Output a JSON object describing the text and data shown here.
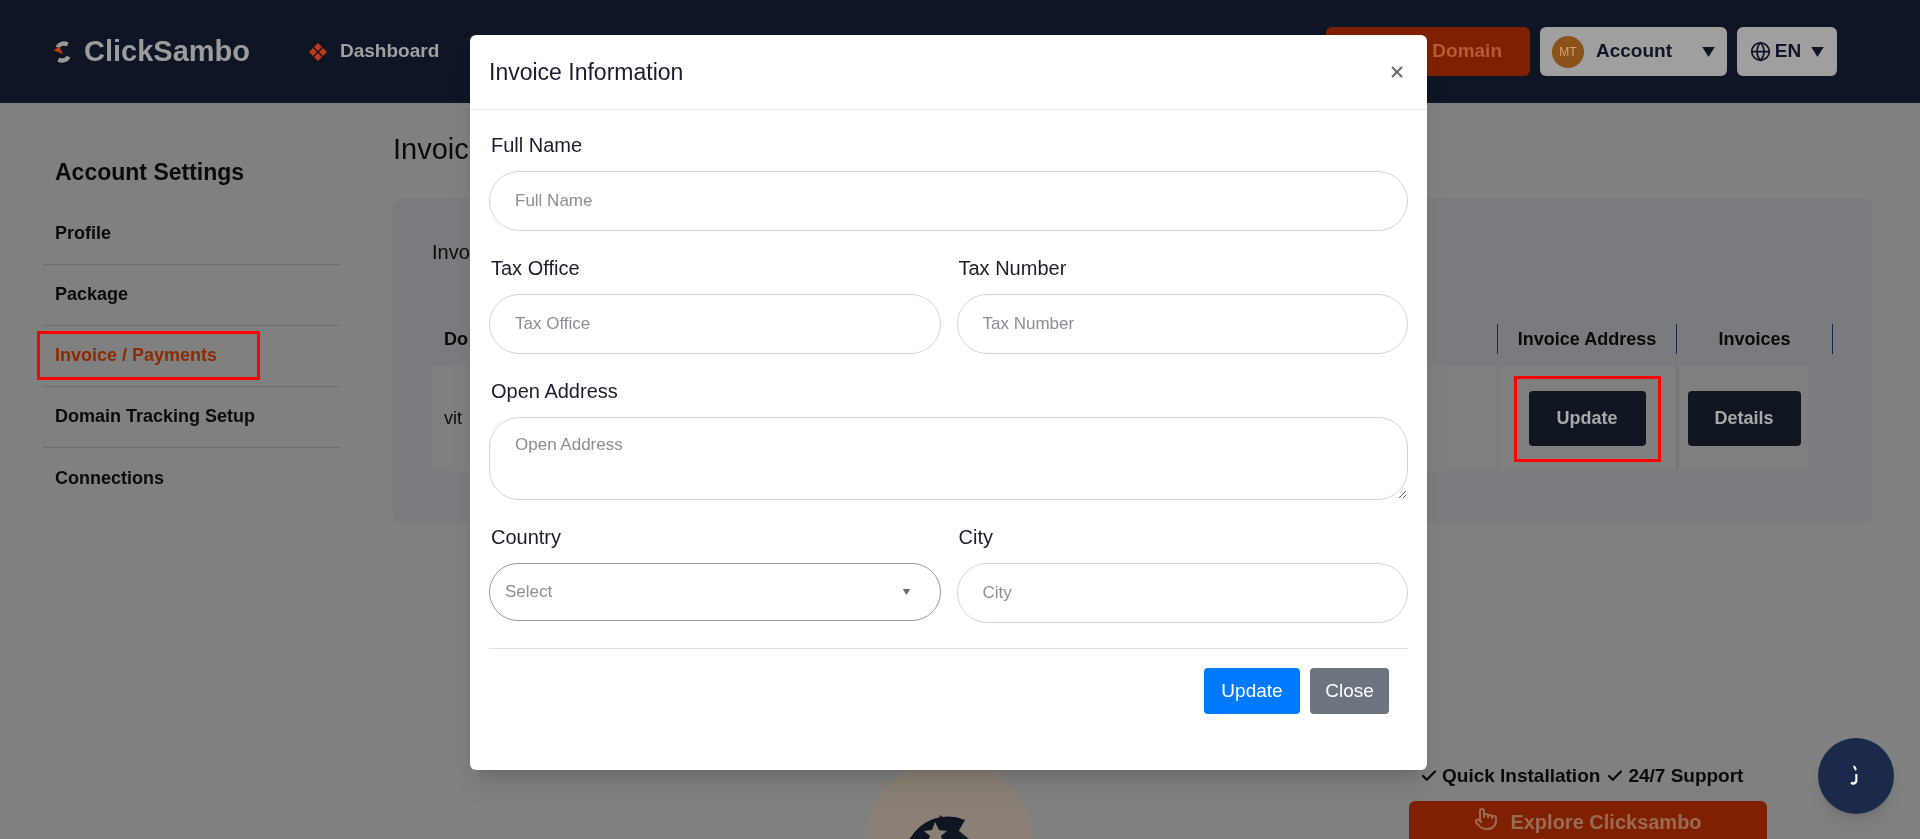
{
  "header": {
    "logo": "ClickSambo",
    "nav": [
      {
        "label": "Dashboard"
      }
    ],
    "domain_button": "Domain",
    "account": {
      "initials": "MT",
      "label": "Account"
    },
    "language": "EN"
  },
  "sidebar": {
    "title": "Account Settings",
    "items": [
      {
        "label": "Profile",
        "selected": false,
        "highlighted": false
      },
      {
        "label": "Package",
        "selected": false,
        "highlighted": false
      },
      {
        "label": "Invoice / Payments",
        "selected": true,
        "highlighted": true
      },
      {
        "label": "Domain Tracking Setup",
        "selected": false,
        "highlighted": false
      },
      {
        "label": "Connections",
        "selected": false,
        "highlighted": false
      }
    ]
  },
  "main": {
    "title": "Invoic",
    "card_title": "Invo",
    "table": {
      "columns": [
        "Do",
        "Invoice Address",
        "Invoices"
      ],
      "rows": [
        {
          "cell": "vit",
          "update": "Update",
          "update_highlighted": true,
          "details": "Details"
        }
      ]
    }
  },
  "promo": {
    "features": [
      "Quick Installation",
      "24/7 Support"
    ],
    "button": "Explore Clicksambo"
  },
  "modal": {
    "title": "Invoice Information",
    "rows": [
      [
        {
          "kind": "text",
          "label": "Full Name",
          "placeholder": "Full Name"
        }
      ],
      [
        {
          "kind": "text",
          "label": "Tax Office",
          "placeholder": "Tax Office"
        },
        {
          "kind": "text",
          "label": "Tax Number",
          "placeholder": "Tax Number"
        }
      ],
      [
        {
          "kind": "textarea",
          "label": "Open Address",
          "placeholder": "Open Address"
        }
      ],
      [
        {
          "kind": "select",
          "label": "Country",
          "placeholder": "Select"
        },
        {
          "kind": "text",
          "label": "City",
          "placeholder": "City"
        }
      ]
    ],
    "buttons": [
      {
        "label": "Update",
        "kind": "primary"
      },
      {
        "label": "Close",
        "kind": "secondary"
      }
    ]
  }
}
